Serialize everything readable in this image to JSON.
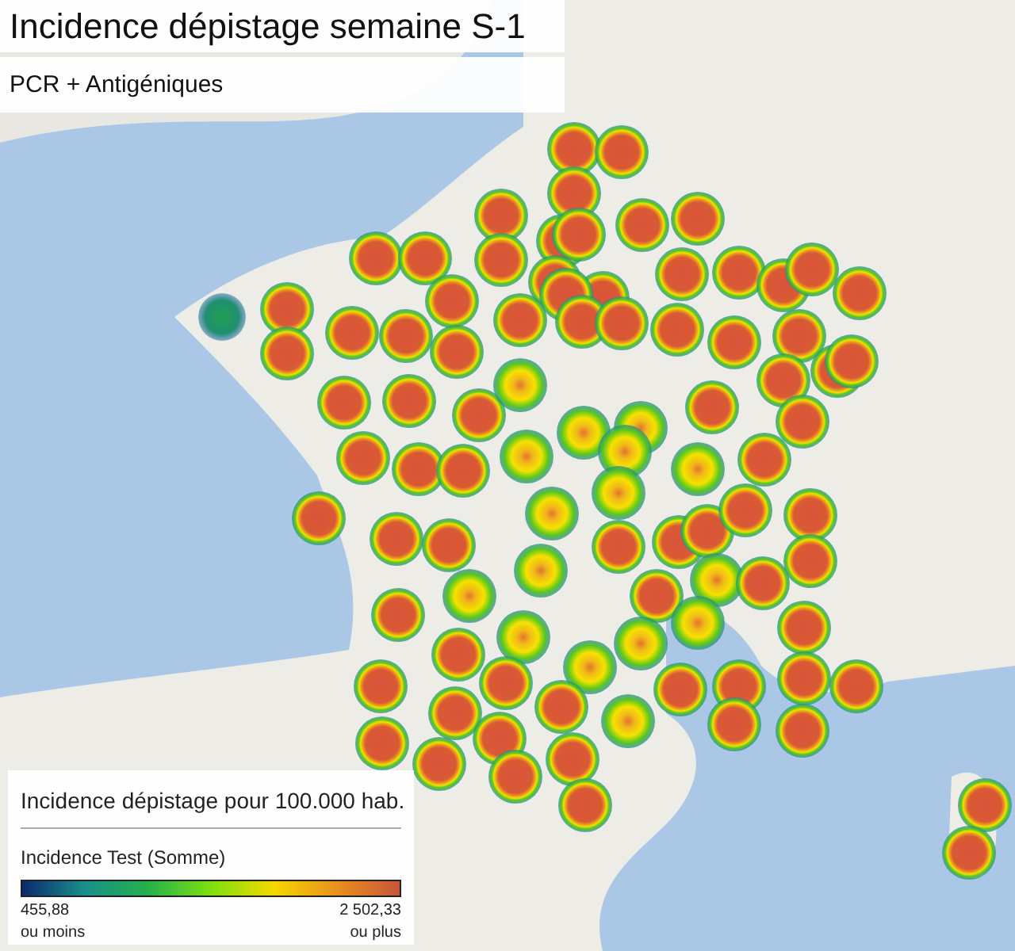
{
  "title": "Incidence dépistage semaine S-1",
  "subtitle": "PCR + Antigéniques",
  "legend": {
    "title": "Incidence dépistage pour 100.000 hab.",
    "measure": "Incidence Test (Somme)",
    "min_value": "455,88",
    "min_caption": "ou moins",
    "max_value": "2 502,33",
    "max_caption": "ou plus"
  }
}
